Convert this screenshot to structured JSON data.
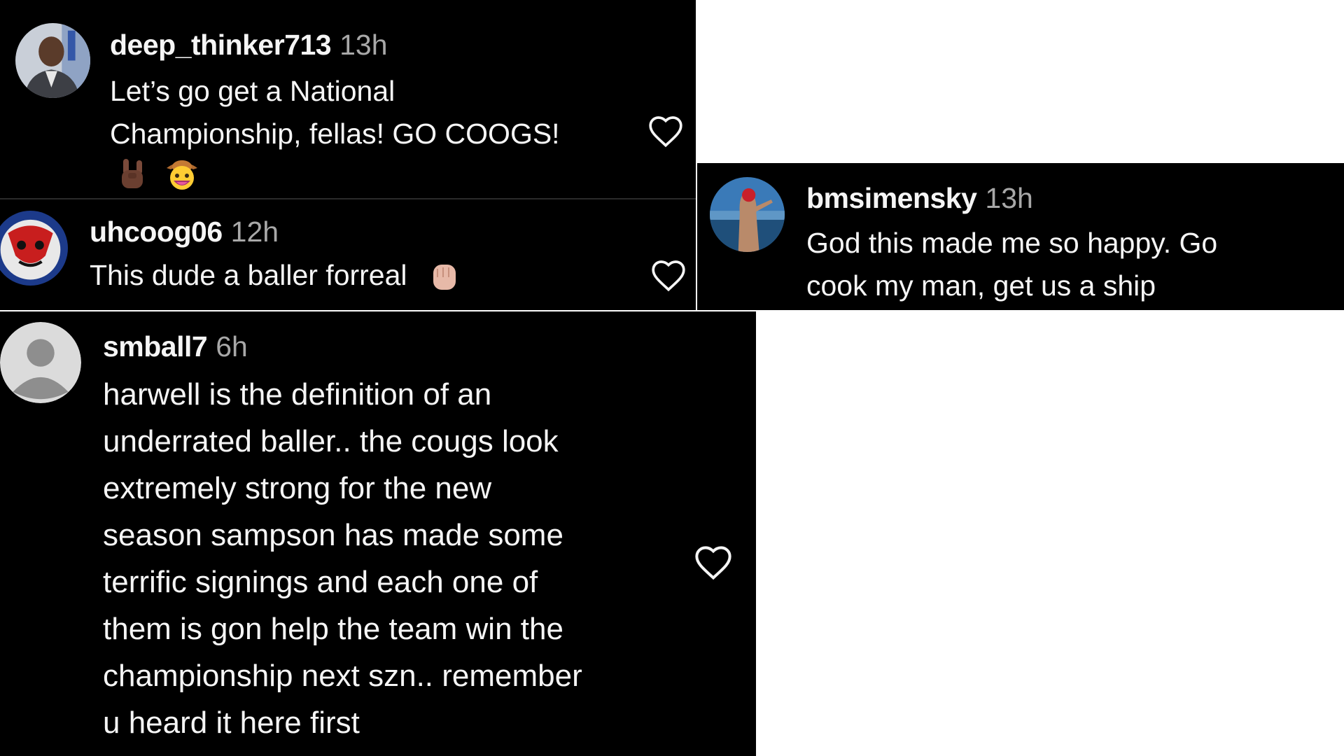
{
  "comments": [
    {
      "username": "deep_thinker713",
      "time": "13h",
      "text_lines": [
        "Let’s go get a National",
        "Championship, fellas! GO COOGS!"
      ],
      "emojis": [
        "sign-of-the-horns-emoji",
        "cowboy-hat-face-emoji"
      ]
    },
    {
      "username": "uhcoog06",
      "time": "12h",
      "text": "This dude a baller forreal",
      "emojis": [
        "raised-fist-emoji"
      ]
    },
    {
      "username": "bmsimensky",
      "time": "13h",
      "text_lines": [
        "God this made me so happy. Go",
        "cook my man, get us a ship"
      ]
    },
    {
      "username": "smball7",
      "time": "6h",
      "text_lines": [
        "harwell is the definition of an",
        "underrated baller.. the cougs look",
        "extremely strong for the new",
        "season sampson has made some",
        "terrific signings and each one of",
        "them is gon help the team win the",
        "championship next szn.. remember",
        "u heard it here first"
      ]
    }
  ],
  "colors": {
    "background": "#000000",
    "text": "#f5f5f5",
    "timestamp": "#a8a8a8",
    "page": "#ffffff"
  }
}
